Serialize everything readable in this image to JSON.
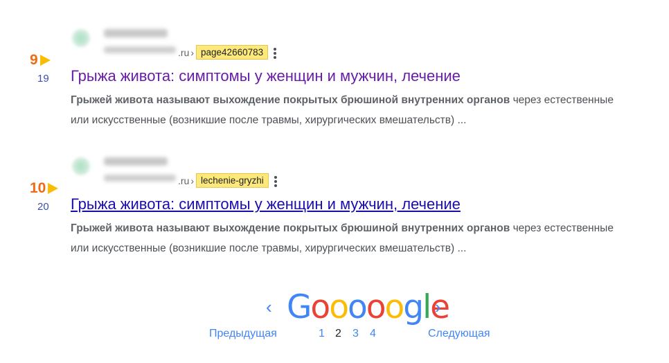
{
  "results": [
    {
      "rank": "9",
      "position": "19",
      "url_suffix": ".ru",
      "url_separator": "›",
      "url_path": "page42660783",
      "title": "Грыжа живота: симптомы у женщин и мужчин, лечение",
      "snippet_bold": "Грыжей живота называют выхождение покрытых брюшиной внутренних органов",
      "snippet_rest": " через естественные или искусственные (возникшие после травмы, хирургических вмешательств) ..."
    },
    {
      "rank": "10",
      "position": "20",
      "url_suffix": ".ru",
      "url_separator": "›",
      "url_path": "lechenie-gryzhi",
      "title": "Грыжа живота: симптомы у женщин и мужчин, лечение",
      "snippet_bold": "Грыжей живота называют выхождение покрытых брюшиной внутренних органов",
      "snippet_rest": " через естественные или искусственные (возникшие после травмы, хирургических вмешательств) ..."
    }
  ],
  "pagination": {
    "prev_arrow": "‹",
    "next_arrow": "›",
    "logo_letters": [
      "G",
      "o",
      "o",
      "o",
      "o",
      "o",
      "g",
      "l",
      "e"
    ],
    "prev_label": "Предыдущая",
    "next_label": "Следующая",
    "pages": [
      "1",
      "2",
      "3",
      "4"
    ],
    "current_page": "2"
  },
  "colors": {
    "rank_number": "#f06a13",
    "rank_arrow": "#fbbc05",
    "visited_title": "#681da8",
    "link_title": "#1a0dab",
    "url_highlight": "#fde87a",
    "pager_blue": "#4285f4"
  },
  "icons": {
    "rank_marker": "triangle-right-icon",
    "menu": "kebab-menu-icon",
    "favicon": "site-favicon-icon"
  }
}
